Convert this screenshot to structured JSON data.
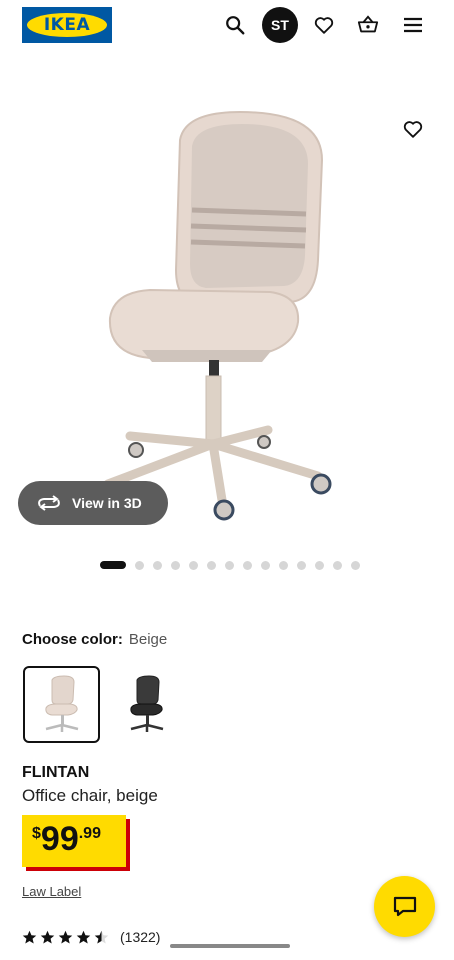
{
  "header": {
    "logo_text": "IKEA",
    "avatar_initials": "ST",
    "icons": [
      "search-icon",
      "heart-icon",
      "basket-icon",
      "menu-icon"
    ]
  },
  "gallery": {
    "view_3d_label": "View in 3D",
    "slide_count": 14,
    "active_slide": 1
  },
  "color_choice": {
    "label": "Choose color:",
    "value": "Beige",
    "swatches": [
      "beige",
      "black"
    ],
    "selected": "beige"
  },
  "product": {
    "name": "FLINTAN",
    "description": "Office chair, beige",
    "price": {
      "currency": "$",
      "integer": "99",
      "decimal": ".99"
    },
    "law_label": "Law Label",
    "rating": 4.5,
    "review_count": "(1322)"
  },
  "colors": {
    "ikea_blue": "#0058a3",
    "ikea_yellow": "#ffdb00",
    "price_red": "#cc0008"
  }
}
